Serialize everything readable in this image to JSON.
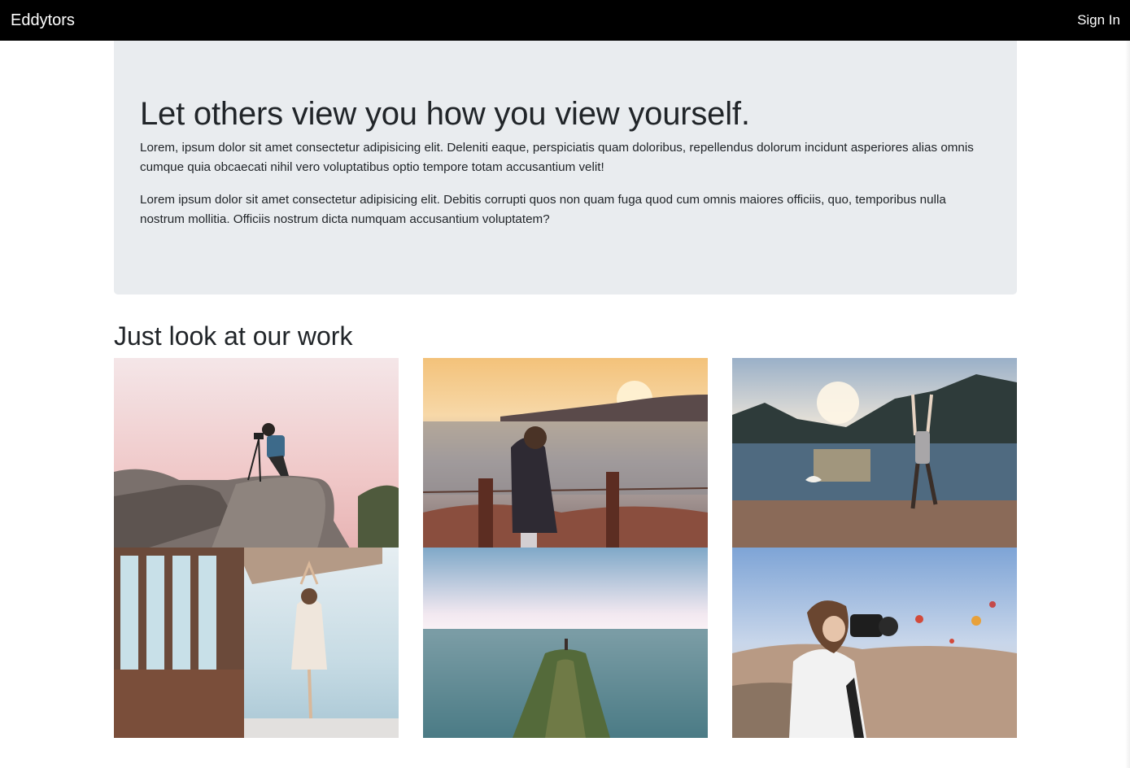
{
  "navbar": {
    "brand": "Eddytors",
    "signin_label": "Sign In"
  },
  "hero": {
    "title": "Let others view you how you view yourself.",
    "paragraph_1": "Lorem, ipsum dolor sit amet consectetur adipisicing elit. Deleniti eaque, perspiciatis quam doloribus, repellendus dolorum incidunt asperiores alias omnis cumque quia obcaecati nihil vero voluptatibus optio tempore totam accusantium velit!",
    "paragraph_2": "Lorem ipsum dolor sit amet consectetur adipisicing elit. Debitis corrupti quos non quam fuga quod cum omnis maiores officiis, quo, temporibus nulla nostrum mollitia. Officiis nostrum dicta numquam accusantium voluptatem?"
  },
  "work": {
    "title": "Just look at our work"
  },
  "colors": {
    "navbar_bg": "#000000",
    "hero_bg": "#e9ecef",
    "text": "#212529"
  }
}
